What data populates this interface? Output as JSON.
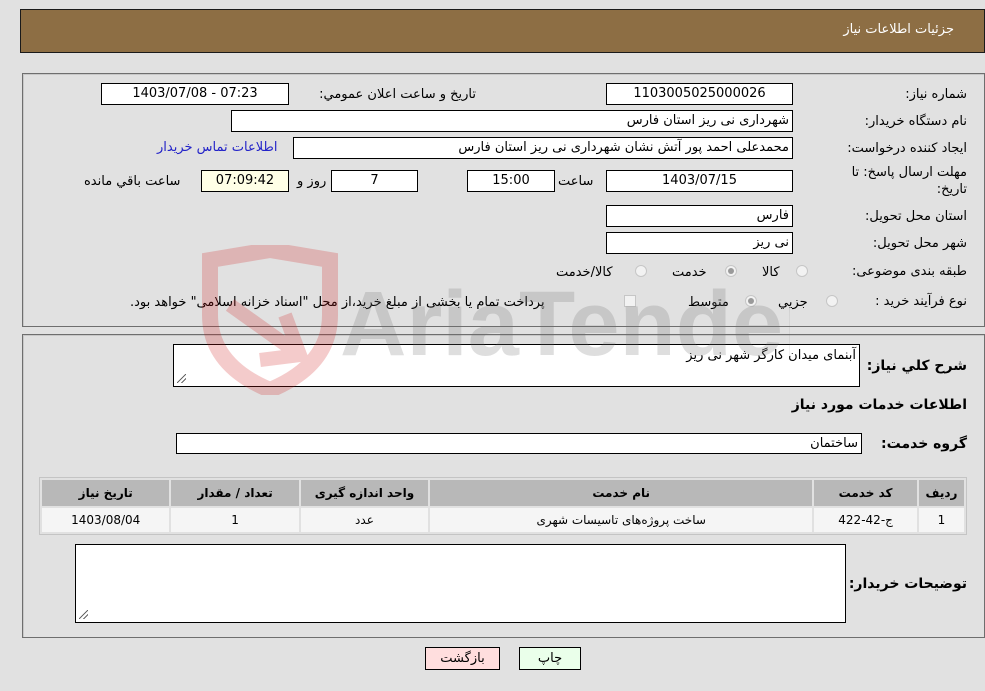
{
  "header": {
    "title": "جزئیات اطلاعات نیاز"
  },
  "form": {
    "need_number": {
      "label": "شماره نیاز:",
      "value": "1103005025000026"
    },
    "announce_datetime": {
      "label": "تاریخ و ساعت اعلان عمومي:",
      "value": "1403/07/08 - 07:23"
    },
    "buyer_org": {
      "label": "نام دستگاه خریدار:",
      "value": "شهرداری نی ریز استان فارس"
    },
    "requester": {
      "label": "ایجاد کننده درخواست:",
      "value": "محمدعلی احمد پور آتش نشان شهرداری نی ریز استان فارس"
    },
    "buyer_contact_link": "اطلاعات تماس خریدار",
    "deadline": {
      "label_line1": "مهلت ارسال پاسخ: تا",
      "label_line2": "تاریخ:",
      "date": "1403/07/15",
      "time_label": "ساعت",
      "time": "15:00",
      "days": "7",
      "days_label": "روز و",
      "remaining": "07:09:42",
      "remaining_label": "ساعت باقي مانده"
    },
    "delivery_province": {
      "label": "استان محل تحویل:",
      "value": "فارس"
    },
    "delivery_city": {
      "label": "شهر محل تحویل:",
      "value": "نی ریز"
    },
    "category": {
      "label": "طبقه بندی موضوعی:",
      "options": [
        "کالا",
        "خدمت",
        "کالا/خدمت"
      ],
      "selected": "خدمت"
    },
    "purchase_type": {
      "label": "نوع فرآیند خرید :",
      "options": [
        "جزیي",
        "متوسط"
      ],
      "selected": "متوسط",
      "treasury_note": "پرداخت تمام یا بخشی از مبلغ خرید،از محل \"اسناد خزانه اسلامی\" خواهد بود."
    }
  },
  "details": {
    "description_label": "شرح کلي نیاز:",
    "description_value": "آبنمای میدان کارگر شهر نی ریز",
    "services_heading": "اطلاعات خدمات مورد نیاز",
    "service_group_label": "گروه خدمت:",
    "service_group_value": "ساختمان",
    "table": {
      "headers": [
        "ردیف",
        "کد خدمت",
        "نام خدمت",
        "واحد اندازه گیری",
        "تعداد / مقدار",
        "تاریخ نیاز"
      ],
      "rows": [
        [
          "1",
          "ج-42-422",
          "ساخت پروژه‌های تاسیسات شهری",
          "عدد",
          "1",
          "1403/08/04"
        ]
      ]
    },
    "buyer_notes_label": "توضیحات خریدار:",
    "buyer_notes_value": ""
  },
  "buttons": {
    "print": "چاپ",
    "back": "بازگشت"
  },
  "watermark": "AriaTender.neT",
  "colors": {
    "header_bg": "#8d6e44",
    "print_bg": "#eaffea",
    "back_bg": "#ffdede",
    "link": "#2323c8"
  }
}
